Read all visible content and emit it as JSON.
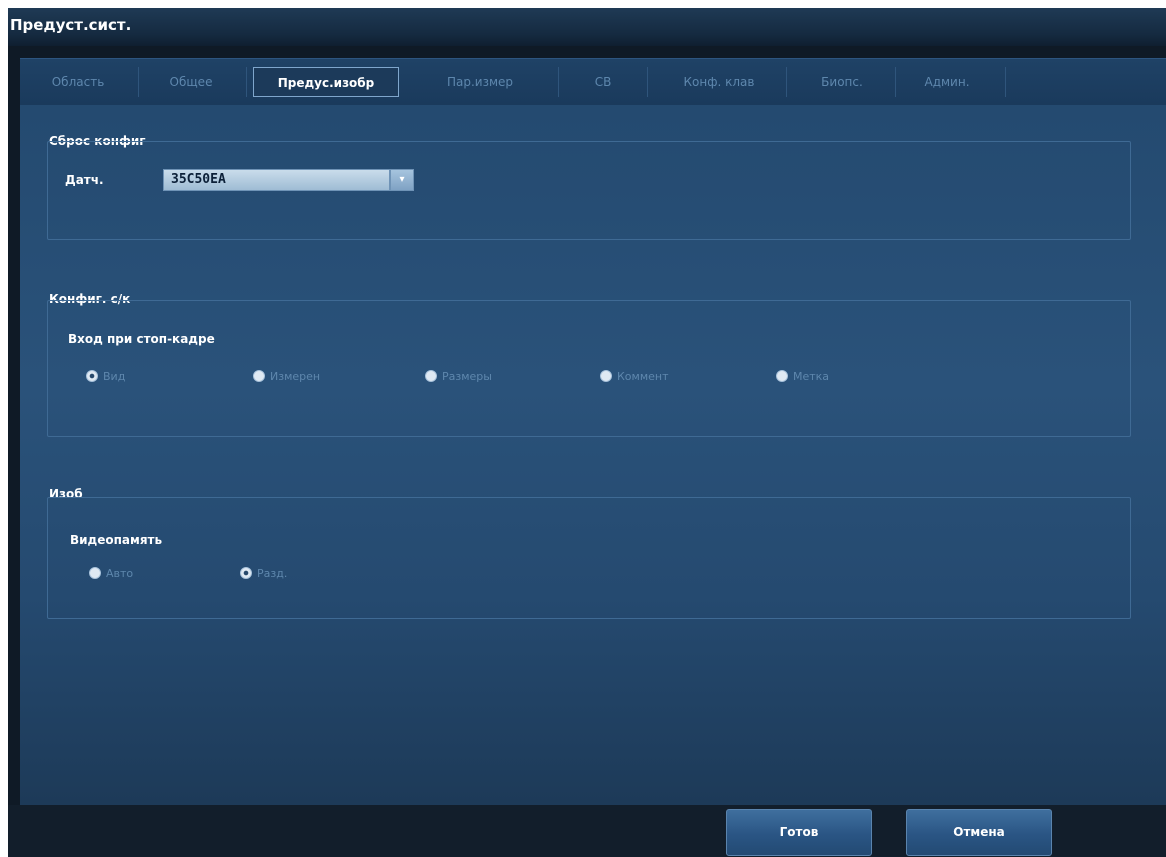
{
  "window": {
    "title": "Предуст.сист."
  },
  "tabs": [
    {
      "label": "Область",
      "active": false
    },
    {
      "label": "Общее",
      "active": false
    },
    {
      "label": "Предус.изобр",
      "active": true
    },
    {
      "label": "Пар.измер",
      "active": false
    },
    {
      "label": "CB",
      "active": false
    },
    {
      "label": "Конф. клав",
      "active": false
    },
    {
      "label": "Биопс.",
      "active": false
    },
    {
      "label": "Админ.",
      "active": false
    }
  ],
  "reset": {
    "title": "Сброс конфиг",
    "probe_label": "Датч.",
    "probe_value": "35C50EA"
  },
  "freeze": {
    "title": "Конфиг. с/к",
    "subtitle": "Вход при стоп-кадре",
    "options": [
      {
        "label": "Вид",
        "checked": true
      },
      {
        "label": "Измерен",
        "checked": false
      },
      {
        "label": "Размеры",
        "checked": false
      },
      {
        "label": "Коммент",
        "checked": false
      },
      {
        "label": "Метка",
        "checked": false
      }
    ]
  },
  "image": {
    "title": "Изоб",
    "subtitle": "Видеопамять",
    "options": [
      {
        "label": "Авто",
        "checked": false
      },
      {
        "label": "Разд.",
        "checked": true
      }
    ]
  },
  "buttons": {
    "ok": "Готов",
    "cancel": "Отмена"
  }
}
